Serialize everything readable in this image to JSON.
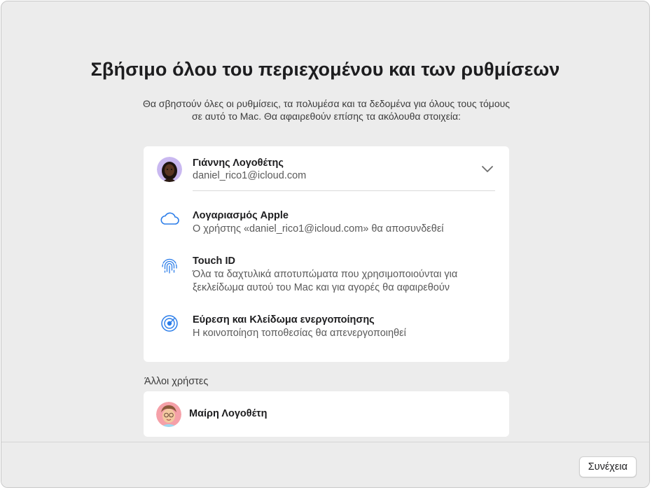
{
  "title": "Σβήσιμο όλου του περιεχομένου και των ρυθμίσεων",
  "description": "Θα σβηστούν όλες οι ρυθμίσεις, τα πολυμέσα και τα δεδομένα για όλους τους τόμους σε αυτό το Mac. Θα αφαιρεθούν επίσης τα ακόλουθα στοιχεία:",
  "user": {
    "name": "Γιάννης Λογοθέτης",
    "email": "daniel_rico1@icloud.com"
  },
  "items": [
    {
      "title": "Λογαριασμός Apple",
      "subtitle": "Ο χρήστης «daniel_rico1@icloud.com» θα αποσυνδεθεί",
      "icon": "cloud-icon"
    },
    {
      "title": "Touch ID",
      "subtitle_line1": "Όλα τα δαχτυλικά αποτυπώματα που χρησιμοποιούνται για",
      "subtitle_line2": "ξεκλείδωμα αυτού του Mac και για αγορές θα αφαιρεθούν",
      "icon": "fingerprint-icon"
    },
    {
      "title": "Εύρεση και Κλείδωμα ενεργοποίησης",
      "subtitle": "Η κοινοποίηση τοποθεσίας θα απενεργοποιηθεί",
      "icon": "find-my-icon"
    }
  ],
  "other_users_label": "Άλλοι χρήστες",
  "other_users": [
    {
      "name": "Μαίρη Λογοθέτη"
    }
  ],
  "continue_label": "Συνέχεια",
  "colors": {
    "accent": "#2b7de9",
    "background": "#ececec",
    "card": "#ffffff"
  }
}
